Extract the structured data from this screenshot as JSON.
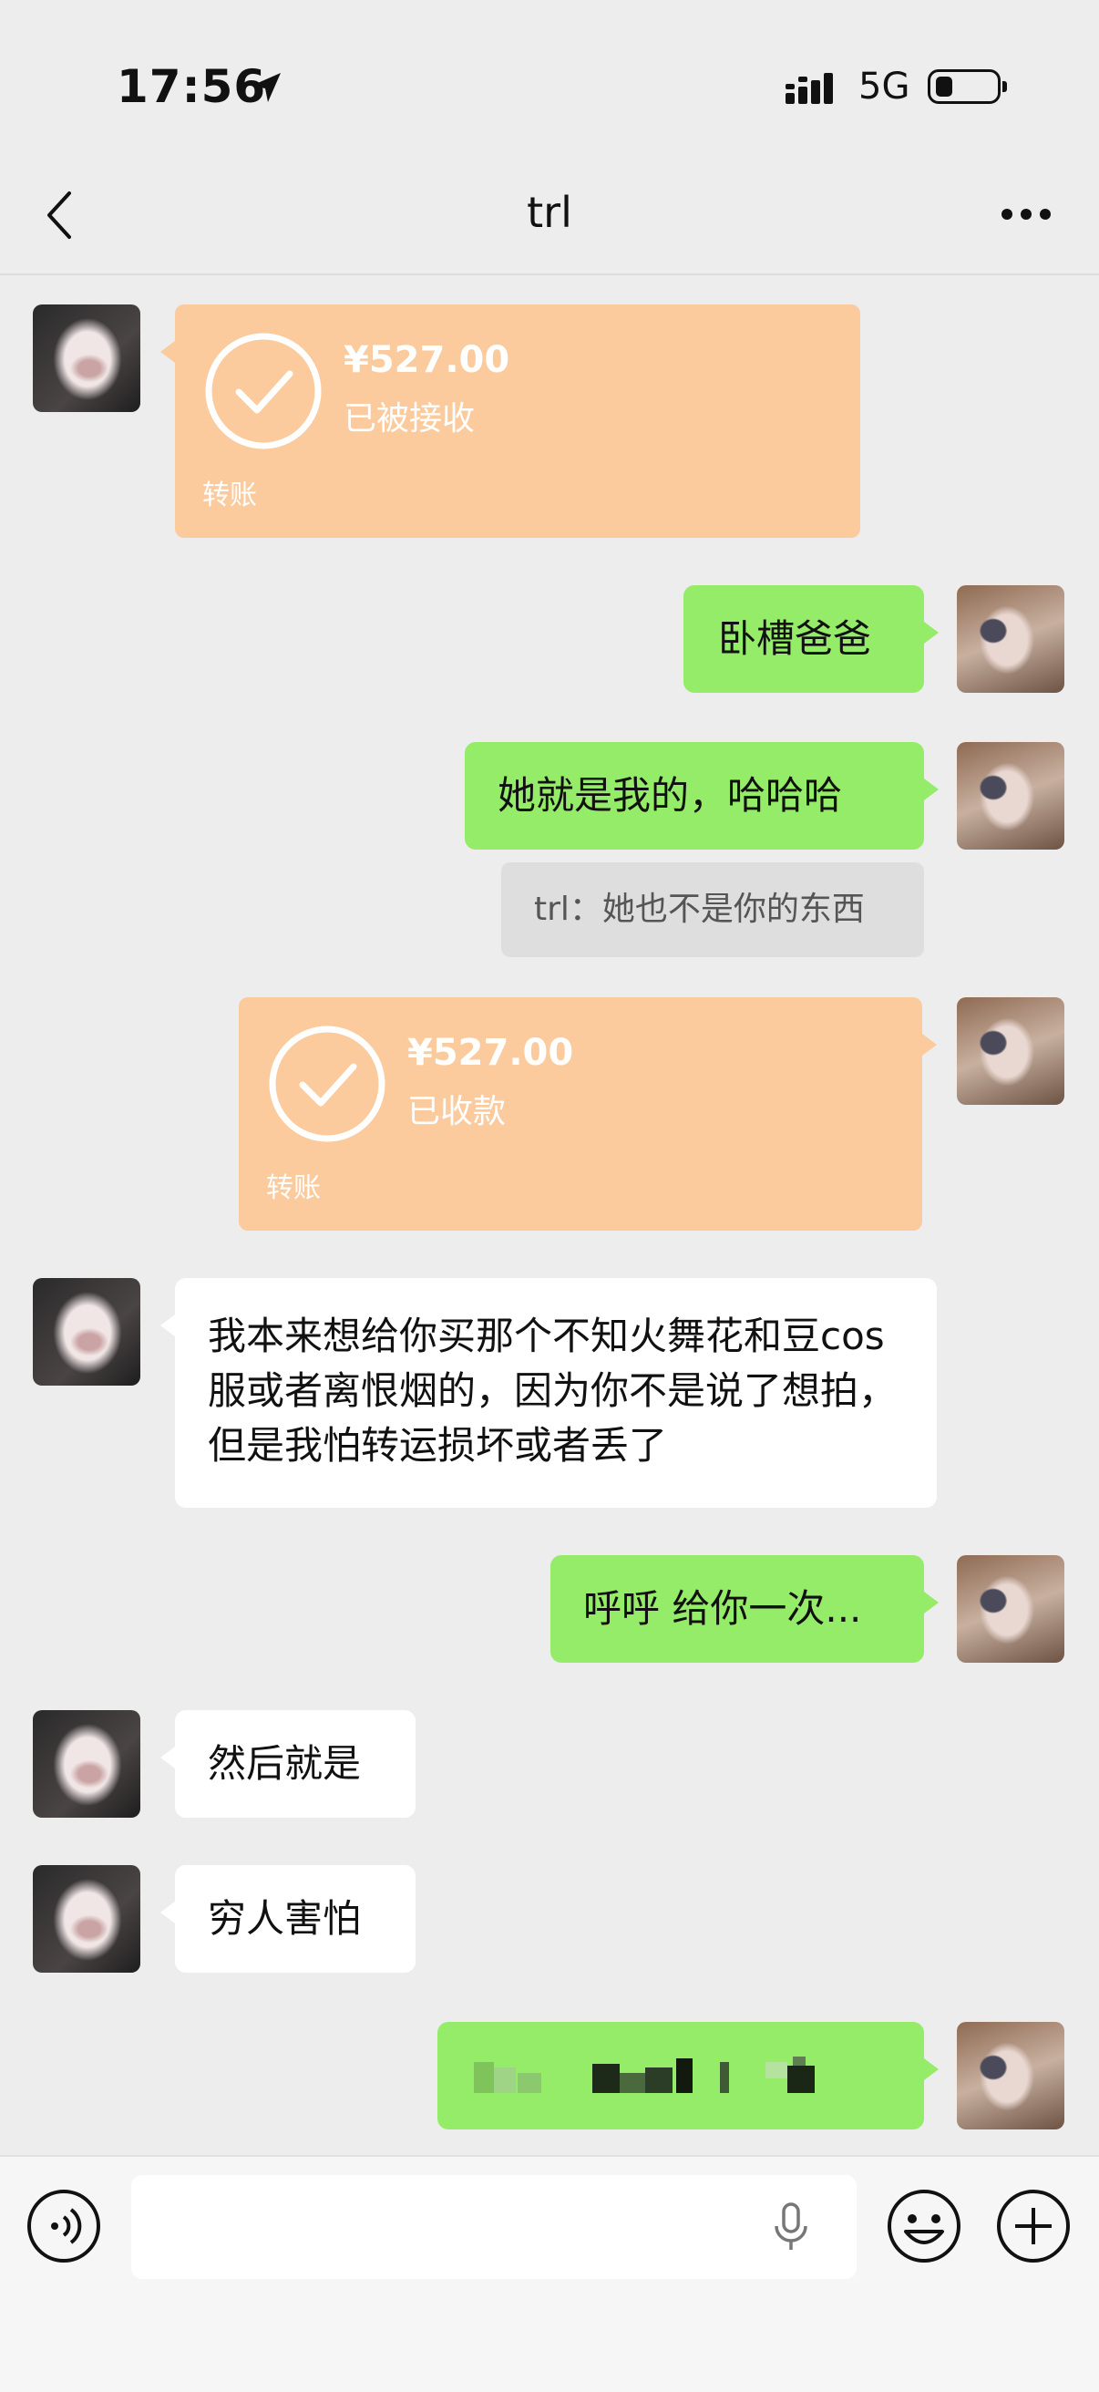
{
  "status_bar": {
    "time": "17:56",
    "network": "5G"
  },
  "nav": {
    "title": "trl"
  },
  "messages": {
    "transfer_received": {
      "amount": "¥527.00",
      "status": "已被接收",
      "label": "转账"
    },
    "m1": "卧槽爸爸",
    "m2": "她就是我的，哈哈哈",
    "quote": "trl：她也不是你的东西",
    "transfer_sent": {
      "amount": "¥527.00",
      "status": "已收款",
      "label": "转账"
    },
    "long_msg": "我本来想给你买那个不知火舞花和豆cos服或者离恨烟的，因为你不是说了想拍，但是我怕转运损坏或者丢了",
    "m3": "呼呼 给你一次...",
    "m4": "然后就是",
    "m5": "穷人害怕"
  },
  "colors": {
    "sent_bubble": "#95ec69",
    "transfer_card": "#fbcb9d",
    "background": "#ededed"
  }
}
